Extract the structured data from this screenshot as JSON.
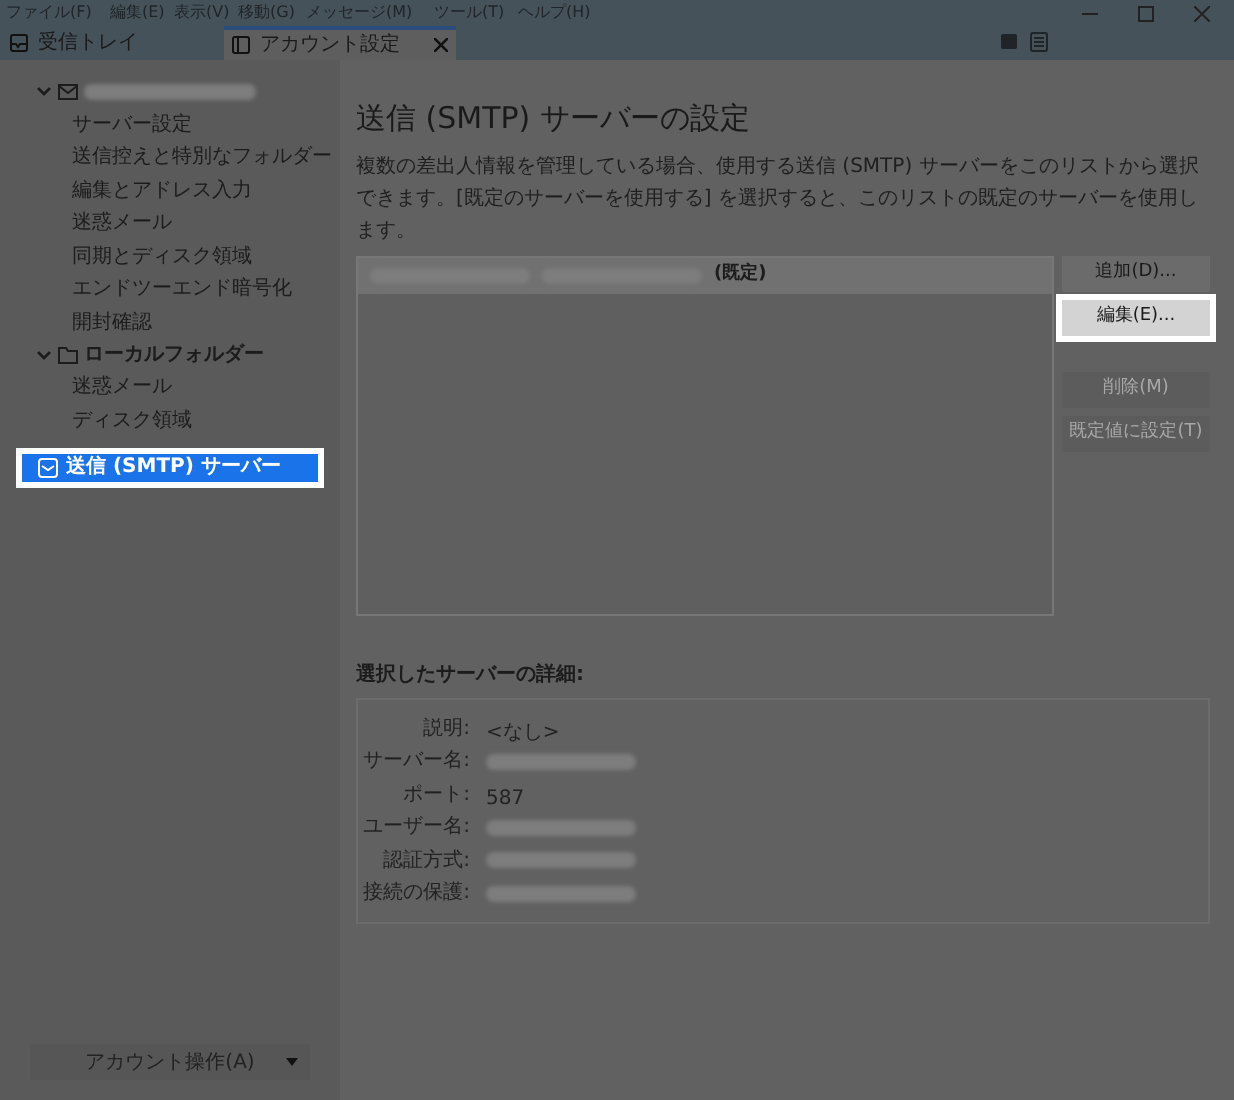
{
  "menu": [
    "ファイル(F)",
    "編集(E)",
    "表示(V)",
    "移動(G)",
    "メッセージ(M)",
    "ツール(T)",
    "ヘルプ(H)"
  ],
  "tabs": [
    {
      "label": "受信トレイ",
      "kind": "inbox",
      "selected": false
    },
    {
      "label": "アカウント設定",
      "kind": "settings",
      "selected": true
    }
  ],
  "sidebar": {
    "items": [
      {
        "kind": "account",
        "expanded": true,
        "children": [
          {
            "label": "サーバー設定",
            "selected": false
          },
          {
            "label": "送信控えと特別なフォルダー",
            "selected": false
          },
          {
            "label": "編集とアドレス入力",
            "selected": false
          },
          {
            "label": "迷惑メール",
            "selected": false
          },
          {
            "label": "同期とディスク領域",
            "selected": false
          },
          {
            "label": "エンドツーエンド暗号化",
            "selected": false
          },
          {
            "label": "開封確認",
            "selected": false
          }
        ]
      },
      {
        "kind": "folder",
        "label": "ローカルフォルダー",
        "expanded": true,
        "children": [
          {
            "label": "迷惑メール",
            "selected": false
          },
          {
            "label": "ディスク領域",
            "selected": false
          }
        ]
      },
      {
        "kind": "smtp",
        "label": "送信 (SMTP) サーバー",
        "selected": true
      }
    ],
    "account_actions": "アカウント操作(A)"
  },
  "main": {
    "title": "送信 (SMTP) サーバーの設定",
    "description": "複数の差出人情報を管理している場合、使用する送信 (SMTP) サーバーをこのリストから選択できます。[既定のサーバーを使用する] を選択すると、このリストの既定のサーバーを使用します。",
    "servers": [
      {
        "tag": "(既定)",
        "selected": true
      }
    ],
    "buttons": [
      {
        "label": "追加(D)...",
        "disabled": false,
        "highlighted": false
      },
      {
        "label": "編集(E)...",
        "disabled": false,
        "highlighted": true
      },
      {
        "label": "削除(M)",
        "disabled": true,
        "highlighted": false
      },
      {
        "label": "既定値に設定(T)",
        "disabled": true,
        "highlighted": false
      }
    ],
    "details": {
      "title": "選択したサーバーの詳細:",
      "rows": [
        {
          "label": "説明:",
          "value": "<なし>"
        },
        {
          "label": "サーバー名:"
        },
        {
          "label": "ポート:",
          "value": "587"
        },
        {
          "label": "ユーザー名:"
        },
        {
          "label": "認証方式:"
        },
        {
          "label": "接続の保護:"
        }
      ]
    }
  }
}
